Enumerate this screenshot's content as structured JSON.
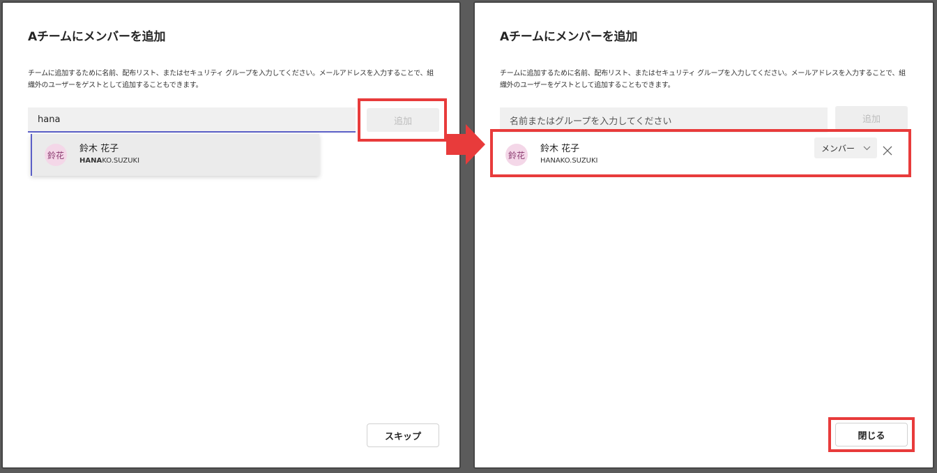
{
  "left_panel": {
    "title": "Aチームにメンバーを追加",
    "description": "チームに追加するために名前、配布リスト、またはセキュリティ グループを入力してください。メールアドレスを入力することで、組織外のユーザーをゲストとして追加することもできます。",
    "search_value": "hana",
    "add_label": "追加",
    "suggestion": {
      "avatar": "鈴花",
      "name": "鈴木 花子",
      "email_match": "HANA",
      "email_rest": "KO.SUZUKI"
    },
    "skip_label": "スキップ"
  },
  "right_panel": {
    "title": "Aチームにメンバーを追加",
    "description": "チームに追加するために名前、配布リスト、またはセキュリティ グループを入力してください。メールアドレスを入力することで、組織外のユーザーをゲストとして追加することもできます。",
    "search_placeholder": "名前またはグループを入力してください",
    "add_label": "追加",
    "member": {
      "avatar": "鈴花",
      "name": "鈴木 花子",
      "email": "HANAKO.SUZUKI",
      "role": "メンバー"
    },
    "close_label": "閉じる"
  },
  "colors": {
    "highlight": "#e83b3b",
    "accent": "#5b5fc7",
    "avatar_bg": "#f4d7e8"
  },
  "icons": {
    "chevron": "chevron-down-icon",
    "remove": "close-icon",
    "arrow": "right-arrow-icon"
  }
}
